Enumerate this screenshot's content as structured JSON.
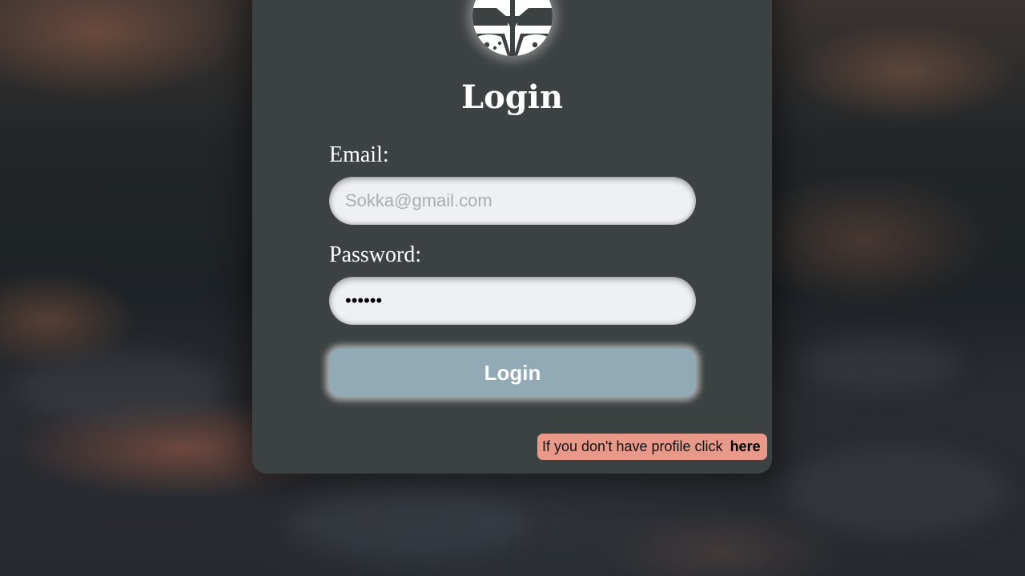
{
  "login_form": {
    "title": "Login",
    "email_label": "Email:",
    "email_placeholder": "Sokka@gmail.com",
    "email_value": "",
    "password_label": "Password:",
    "password_value": "••••••",
    "submit_label": "Login"
  },
  "signup_prompt": {
    "text": "If you don't have profile click",
    "link_label": "here"
  },
  "avatar": {
    "icon": "gamepad-icon"
  }
}
